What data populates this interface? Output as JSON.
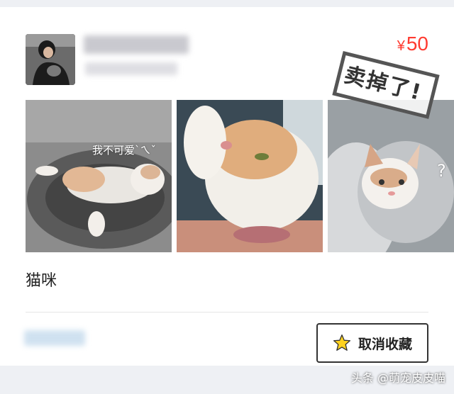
{
  "listing": {
    "price_symbol": "¥",
    "price_value": "50",
    "sold_stamp": "卖掉了!",
    "title": "猫咪",
    "photo1_caption": "我不可爱`ㄟˇ",
    "photo3_mark": "?"
  },
  "actions": {
    "unfavorite_label": "取消收藏"
  },
  "watermark": "头条 @萌宠皮皮喵",
  "colors": {
    "price": "#ff3b30",
    "star": "#ffd21f",
    "page_bg": "#eef0f4"
  }
}
